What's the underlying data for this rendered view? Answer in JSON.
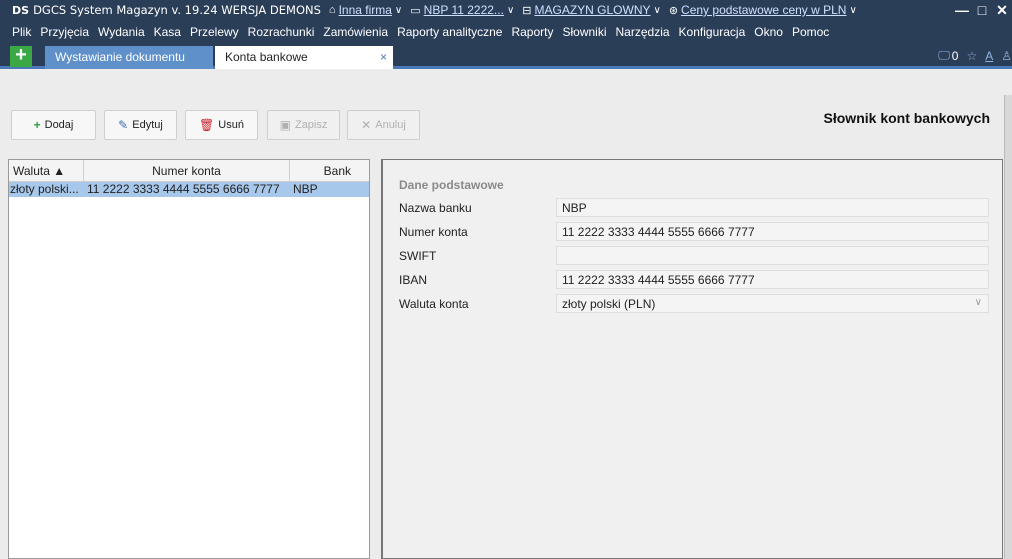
{
  "titlebar": {
    "logo": "DS",
    "app_title": "DGCS System Magazyn v. 19.24  WERSJA DEMONS",
    "firm_link": "Inna firma",
    "account_link": "NBP 11 2222...",
    "warehouse_link": "MAGAZYN GLOWNY",
    "price_link": "Ceny podstawowe ceny w PLN",
    "minimize": "—",
    "maximize": "□",
    "close": "✕"
  },
  "menu": [
    "Plik",
    "Przyjęcia",
    "Wydania",
    "Kasa",
    "Przelewy",
    "Rozrachunki",
    "Zamówienia",
    "Raporty analityczne",
    "Raporty",
    "Słowniki",
    "Narzędzia",
    "Konfiguracja",
    "Okno",
    "Pomoc"
  ],
  "tabs": {
    "add_label": "+",
    "tab1": "Wystawianie dokumentu",
    "tab2": "Konta bankowe",
    "tab2_close": "×",
    "notif_count": "0"
  },
  "toolbar": {
    "add": "Dodaj",
    "edit": "Edytuj",
    "delete": "Usuń",
    "save": "Zapisz",
    "cancel": "Anuluj"
  },
  "panel_title": "Słownik kont bankowych",
  "list": {
    "columns": [
      "Waluta ▲",
      "Numer konta",
      "Bank"
    ],
    "rows": [
      {
        "waluta": "złoty polski...",
        "numer": "11 2222 3333 4444 5555 6666 7777",
        "bank": "NBP"
      }
    ]
  },
  "form": {
    "section": "Dane podstawowe",
    "fields": [
      {
        "label": "Nazwa banku",
        "value": "NBP"
      },
      {
        "label": "Numer konta",
        "value": "11 2222 3333 4444 5555 6666 7777"
      },
      {
        "label": "SWIFT",
        "value": ""
      },
      {
        "label": "IBAN",
        "value": "11 2222 3333 4444 5555 6666 7777"
      },
      {
        "label": "Waluta konta",
        "value": "złoty polski (PLN)"
      }
    ]
  },
  "colors": {
    "titlebar": "#2b3e58",
    "active_tab": "#5f90c9",
    "selection": "#a7c7eb",
    "add_green": "#39a845"
  }
}
